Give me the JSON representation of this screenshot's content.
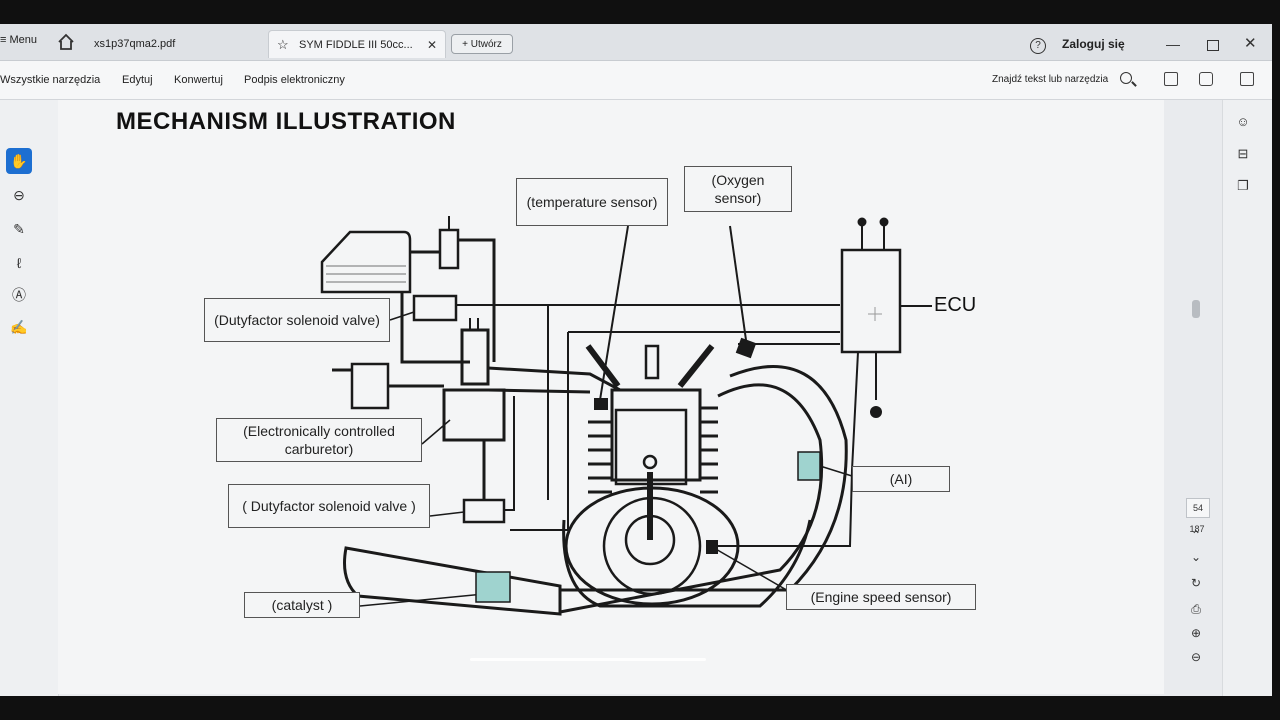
{
  "tabbar": {
    "menu": "Menu",
    "tabs": [
      {
        "label": "xs1p37qma2.pdf"
      },
      {
        "label": "SYM FIDDLE III 50cc..."
      }
    ],
    "new_tab": "+ Utwórz",
    "login": "Zaloguj się"
  },
  "toolbar": {
    "items": [
      "Wszystkie narzędzia",
      "Edytuj",
      "Konwertuj",
      "Podpis elektroniczny"
    ],
    "find_placeholder": "Znajdź tekst lub narzędzia"
  },
  "page_nav": {
    "current": "54",
    "total": "187"
  },
  "document": {
    "title": "MECHANISM ILLUSTRATION",
    "labels": {
      "temperature_sensor": "(temperature sensor)",
      "oxygen_sensor": "(Oxygen sensor)",
      "ecu": "ECU",
      "duty_solenoid_top": "(Dutyfactor solenoid valve)",
      "carburetor": "(Electronically controlled carburetor)",
      "duty_solenoid_bottom": "( Dutyfactor solenoid valve )",
      "ai": "(AI)",
      "catalyst": "(catalyst )",
      "engine_speed_sensor": "(Engine speed sensor)"
    }
  },
  "colors": {
    "accent": "#1d6fd1",
    "sensor_fill": "#9fd3cf"
  }
}
